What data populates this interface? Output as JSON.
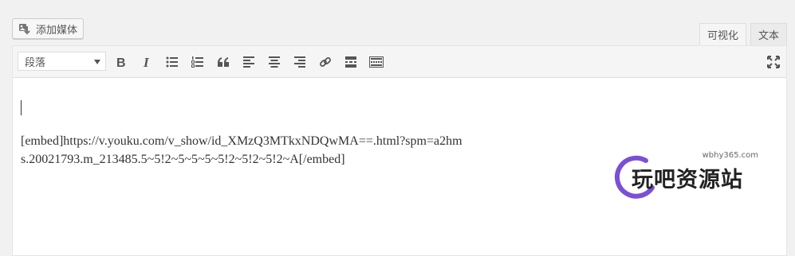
{
  "media_button": {
    "label": "添加媒体",
    "icon": "add-media-icon"
  },
  "tabs": [
    {
      "label": "可视化",
      "active": true
    },
    {
      "label": "文本",
      "active": false
    }
  ],
  "toolbar": {
    "format_select": {
      "value": "段落"
    },
    "buttons": [
      "bold-icon",
      "italic-icon",
      "bulleted-list-icon",
      "numbered-list-icon",
      "blockquote-icon",
      "align-left-icon",
      "align-center-icon",
      "align-right-icon",
      "insert-link-icon",
      "read-more-icon",
      "toolbar-toggle-icon",
      "fullscreen-icon"
    ]
  },
  "content": {
    "embed_line": "[embed]https://v.youku.com/v_show/id_XMzQ3MTkxNDQwMA==.html?spm=a2hms.20021793.m_213485.5~5!2~5~5~5~5!2~5!2~5!2~A[/embed]"
  },
  "watermark": {
    "url": "wbhy365.com",
    "accent_color": "#7b4fd6"
  }
}
